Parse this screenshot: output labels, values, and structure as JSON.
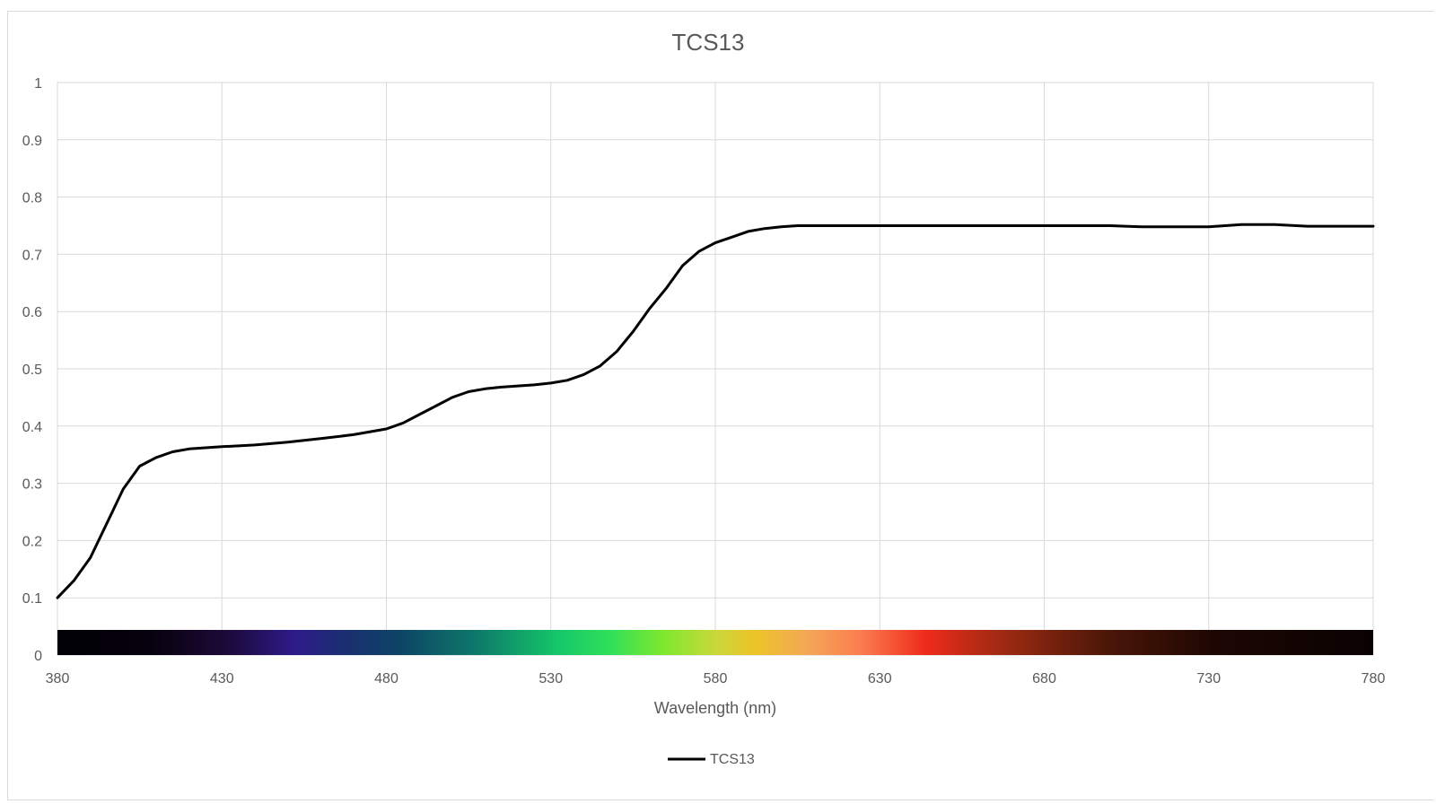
{
  "chart_data": {
    "type": "line",
    "title": "TCS13",
    "xlabel": "Wavelength (nm)",
    "ylabel": "",
    "xlim": [
      380,
      780
    ],
    "ylim": [
      0,
      1
    ],
    "x_ticks": [
      380,
      430,
      480,
      530,
      580,
      630,
      680,
      730,
      780
    ],
    "y_ticks": [
      0,
      0.1,
      0.2,
      0.3,
      0.4,
      0.5,
      0.6,
      0.7,
      0.8,
      0.9,
      1
    ],
    "y_tick_labels": [
      "0",
      "0.1",
      "0.2",
      "0.3",
      "0.4",
      "0.5",
      "0.6",
      "0.7",
      "0.8",
      "0.9",
      "1"
    ],
    "grid": true,
    "legend_position": "bottom",
    "spectrum_bar": true,
    "series": [
      {
        "name": "TCS13",
        "color": "#000000",
        "x": [
          380,
          385,
          390,
          395,
          400,
          405,
          410,
          415,
          420,
          425,
          430,
          440,
          450,
          460,
          470,
          480,
          485,
          490,
          495,
          500,
          505,
          510,
          515,
          520,
          525,
          530,
          535,
          540,
          545,
          550,
          555,
          560,
          565,
          570,
          575,
          580,
          585,
          590,
          595,
          600,
          605,
          610,
          615,
          620,
          630,
          650,
          680,
          700,
          710,
          720,
          730,
          740,
          750,
          760,
          770,
          780
        ],
        "y": [
          0.1,
          0.13,
          0.17,
          0.23,
          0.29,
          0.33,
          0.345,
          0.355,
          0.36,
          0.362,
          0.364,
          0.367,
          0.372,
          0.378,
          0.385,
          0.395,
          0.405,
          0.42,
          0.435,
          0.45,
          0.46,
          0.465,
          0.468,
          0.47,
          0.472,
          0.475,
          0.48,
          0.49,
          0.505,
          0.53,
          0.565,
          0.605,
          0.64,
          0.68,
          0.705,
          0.72,
          0.73,
          0.74,
          0.745,
          0.748,
          0.75,
          0.75,
          0.75,
          0.75,
          0.75,
          0.75,
          0.75,
          0.75,
          0.748,
          0.748,
          0.748,
          0.752,
          0.752,
          0.749,
          0.749,
          0.749
        ]
      }
    ]
  }
}
